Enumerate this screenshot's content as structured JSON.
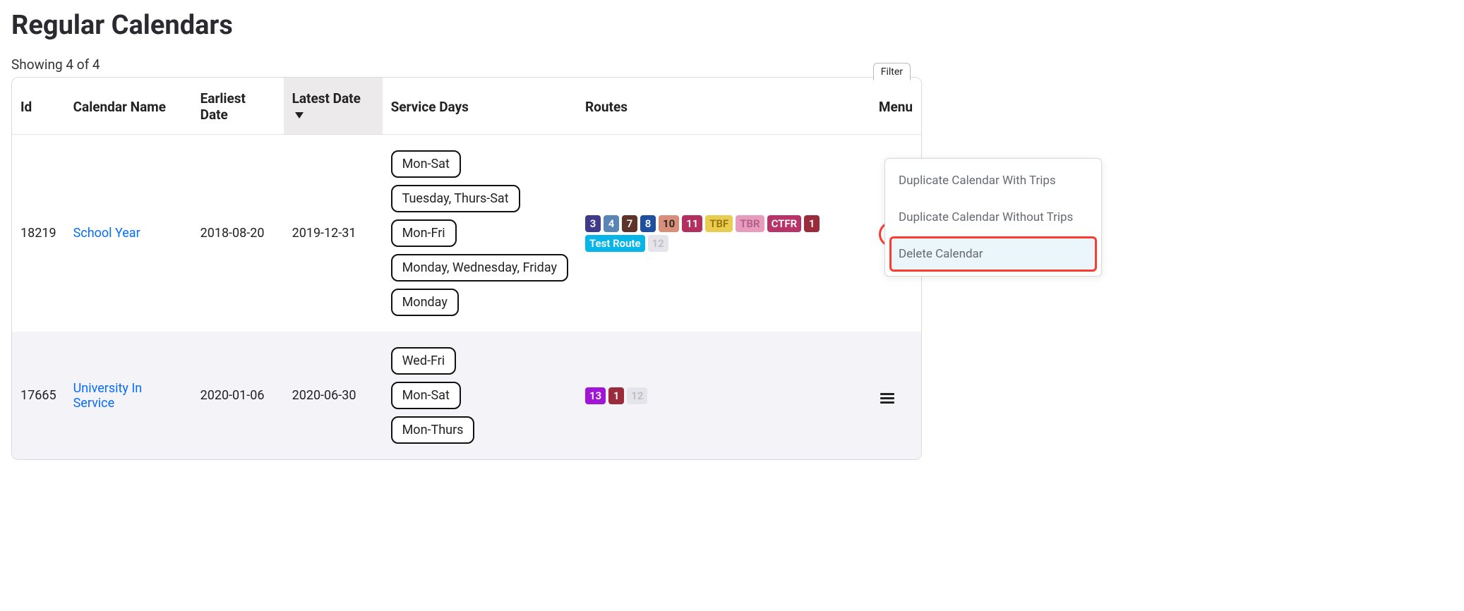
{
  "title": "Regular Calendars",
  "showing": "Showing 4 of 4",
  "filter_label": "Filter",
  "columns": {
    "id": "Id",
    "name": "Calendar Name",
    "earliest": "Earliest Date",
    "latest": "Latest Date",
    "service": "Service Days",
    "routes": "Routes",
    "menu": "Menu"
  },
  "rows": [
    {
      "id": "18219",
      "name": "School Year",
      "earliest": "2018-08-20",
      "latest": "2019-12-31",
      "service_days": [
        "Mon-Sat",
        "Tuesday, Thurs-Sat",
        "Mon-Fri",
        "Monday, Wednesday, Friday",
        "Monday"
      ],
      "routes": [
        {
          "label": "3",
          "bg": "#3f3a8a",
          "fg": "#ffffff"
        },
        {
          "label": "4",
          "bg": "#5a86b5",
          "fg": "#ffffff"
        },
        {
          "label": "7",
          "bg": "#5e342a",
          "fg": "#ffffff"
        },
        {
          "label": "8",
          "bg": "#1f4fa1",
          "fg": "#ffffff"
        },
        {
          "label": "10",
          "bg": "#d88e78",
          "fg": "#222222"
        },
        {
          "label": "11",
          "bg": "#b23060",
          "fg": "#ffffff"
        },
        {
          "label": "TBF",
          "bg": "#e9cc52",
          "fg": "#927708"
        },
        {
          "label": "TBR",
          "bg": "#e79bbd",
          "fg": "#b05f86"
        },
        {
          "label": "CTFR",
          "bg": "#b63468",
          "fg": "#ffffff"
        },
        {
          "label": "1",
          "bg": "#9a2b3a",
          "fg": "#ffffff"
        },
        {
          "label": "Test Route",
          "bg": "#07b6e6",
          "fg": "#ffffff"
        },
        {
          "label": "12",
          "bg": "#e4e4ea",
          "fg": "#bdbdc4"
        }
      ],
      "menu_highlighted": true
    },
    {
      "id": "17665",
      "name": "University In Service",
      "earliest": "2020-01-06",
      "latest": "2020-06-30",
      "service_days": [
        "Wed-Fri",
        "Mon-Sat",
        "Mon-Thurs"
      ],
      "routes": [
        {
          "label": "13",
          "bg": "#a015d6",
          "fg": "#ffffff"
        },
        {
          "label": "1",
          "bg": "#9a2b3a",
          "fg": "#ffffff"
        },
        {
          "label": "12",
          "bg": "#e4e4ea",
          "fg": "#bdbdc4"
        }
      ],
      "menu_highlighted": false
    }
  ],
  "dropdown": {
    "items": [
      {
        "label": "Duplicate Calendar With Trips",
        "selected": false
      },
      {
        "label": "Duplicate Calendar Without Trips",
        "selected": false
      },
      {
        "label": "Delete Calendar",
        "selected": true
      }
    ]
  }
}
